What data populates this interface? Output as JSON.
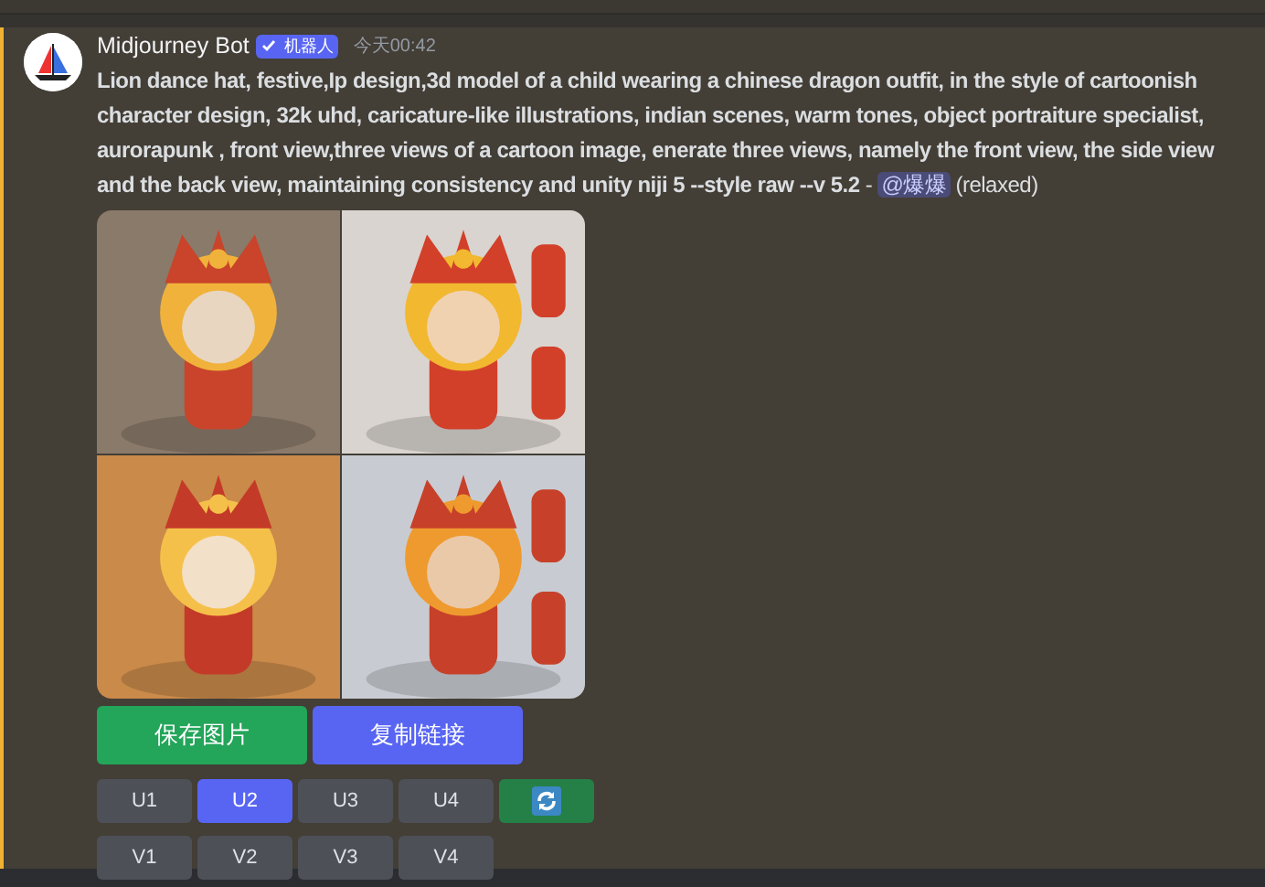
{
  "message": {
    "author": "Midjourney Bot",
    "badge": "机器人",
    "timestamp": "今天00:42",
    "prompt": "Lion dance hat, festive,Ip design,3d model of a child wearing a chinese dragon outfit, in the style of cartoonish character design, 32k uhd, caricature-like illustrations, indian scenes, warm tones, object portraiture specialist, aurorapunk , front view,three views of a cartoon image, enerate three views, namely the front view, the side view and the back view, maintaining consistency and unity niji 5 --style raw --v 5.2",
    "separator": "-",
    "mention": "@爆爆",
    "suffix": "(relaxed)"
  },
  "action_buttons": [
    {
      "label": "保存图片",
      "kind": "save"
    },
    {
      "label": "复制链接",
      "kind": "copy"
    }
  ],
  "button_rows": [
    [
      {
        "label": "U1",
        "kind": "text",
        "selected": false
      },
      {
        "label": "U2",
        "kind": "text",
        "selected": true
      },
      {
        "label": "U3",
        "kind": "text",
        "selected": false
      },
      {
        "label": "U4",
        "kind": "text",
        "selected": false
      },
      {
        "kind": "reroll"
      }
    ],
    [
      {
        "label": "V1",
        "kind": "text",
        "selected": false
      },
      {
        "label": "V2",
        "kind": "text",
        "selected": false
      },
      {
        "label": "V3",
        "kind": "text",
        "selected": false
      },
      {
        "label": "V4",
        "kind": "text",
        "selected": false
      }
    ]
  ]
}
